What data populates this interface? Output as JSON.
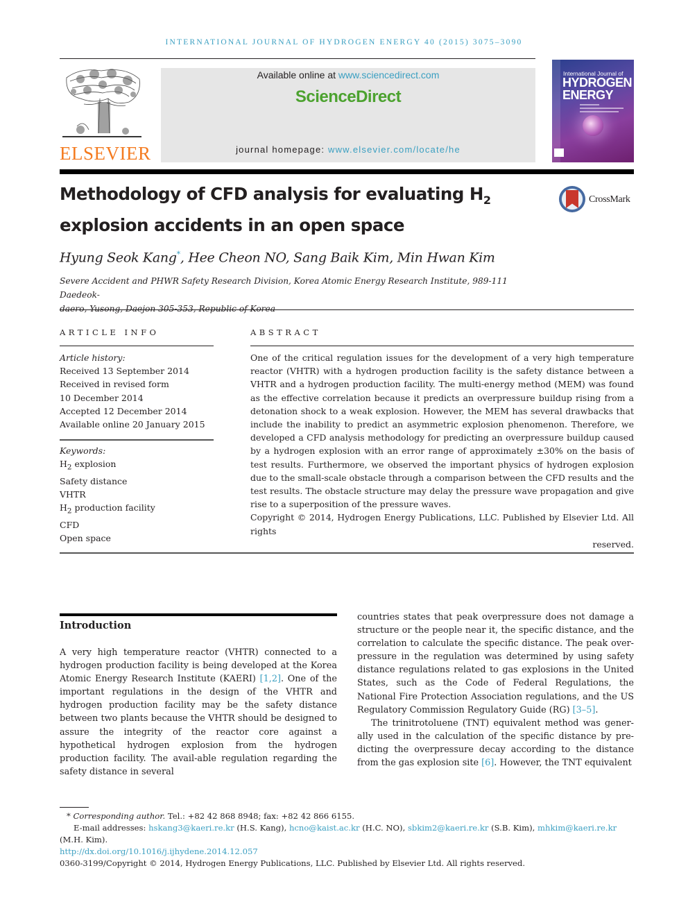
{
  "running_head": "INTERNATIONAL JOURNAL OF HYDROGEN ENERGY 40 (2015) 3075–3090",
  "masthead": {
    "publisher_logo": "ELSEVIER",
    "available_online_prefix": "Available online at ",
    "available_online_link": "www.sciencedirect.com",
    "brand": "ScienceDirect",
    "homepage_prefix": "journal homepage: ",
    "homepage_link": "www.elsevier.com/locate/he",
    "cover": {
      "line1": "International Journal of",
      "line2": "HYDROGEN",
      "line3": "ENERGY"
    }
  },
  "article": {
    "title_part1": "Methodology of CFD analysis for evaluating H",
    "title_sub": "2",
    "title_part2": "explosion accidents in an open space",
    "crossmark_label": "CrossMark",
    "authors_first": "Hyung Seok Kang",
    "authors_mark": "*",
    "authors_rest": ", Hee Cheon NO, Sang Baik Kim, Min Hwan Kim",
    "affiliation_line1": "Severe Accident and PHWR Safety Research Division, Korea Atomic Energy Research Institute, 989-111 Daedeok-",
    "affiliation_line2": "daero, Yusong, Daejon 305-353, Republic of Korea"
  },
  "article_info": {
    "heading": "ARTICLE INFO",
    "history_label": "Article history:",
    "history": [
      "Received 13 September 2014",
      "Received in revised form",
      "10 December 2014",
      "Accepted 12 December 2014",
      "Available online 20 January 2015"
    ],
    "keywords_label": "Keywords:",
    "keywords": [
      {
        "pre": "H",
        "sub": "2",
        "post": " explosion"
      },
      {
        "pre": "Safety distance",
        "sub": "",
        "post": ""
      },
      {
        "pre": "VHTR",
        "sub": "",
        "post": ""
      },
      {
        "pre": "H",
        "sub": "2",
        "post": " production facility"
      },
      {
        "pre": "CFD",
        "sub": "",
        "post": ""
      },
      {
        "pre": "Open space",
        "sub": "",
        "post": ""
      }
    ]
  },
  "abstract": {
    "heading": "ABSTRACT",
    "text": "One of the critical regulation issues for the development of a very high temperature reactor (VHTR) with a hydrogen production facility is the safety distance between a VHTR and a hydrogen production facility. The multi-energy method (MEM) was found as the effective correlation because it predicts an overpressure buildup rising from a detonation shock to a weak explosion. However, the MEM has several drawbacks that include the inability to predict an asymmetric explosion phenomenon. Therefore, we developed a CFD analysis methodology for predicting an overpressure buildup caused by a hydrogen explosion with an error range of approximately ±30% on the basis of test results. Furthermore, we observed the important physics of hydrogen explosion due to the small-scale obstacle through a comparison between the CFD results and the test results. The obstacle structure may delay the pressure wave propagation and give rise to a superposition of the pressure waves.",
    "copyright_line1": "Copyright © 2014, Hydrogen Energy Publications, LLC. Published by Elsevier Ltd. All rights",
    "copyright_line2": "reserved."
  },
  "introduction": {
    "heading": "Introduction",
    "left_p1_a": "A very high temperature reactor (VHTR) connected to a hydrogen production facility is being developed at the Korea Atomic Energy Research Institute (KAERI) ",
    "left_p1_ref": "[1,2]",
    "left_p1_b": ". One of the important regulations in the design of the VHTR and hydrogen production facility may be the safety distance between two plants because the VHTR should be designed to assure the integrity of the reactor core against a hypothetical hydrogen explosion from the hydrogen production facility. The avail-able regulation regarding the safety distance in several",
    "right_p1_a": "countries states that peak overpressure does not damage a structure or the people near it, the specific distance, and the correlation to calculate the specific distance. The peak over-pressure in the regulation was determined by using safety distance regulations related to gas explosions in the United States, such as the Code of Federal Regulations, the National Fire Protection Association regulations, and the US Regulatory Commission Regulatory Guide (RG) ",
    "right_p1_ref": "[3–5]",
    "right_p1_b": ".",
    "right_p2_a": "The trinitrotoluene (TNT) equivalent method was gener-ally used in the calculation of the specific distance by pre-dicting the overpressure decay according to the distance from the gas explosion site ",
    "right_p2_ref": "[6]",
    "right_p2_b": ". However, the TNT equivalent"
  },
  "footnotes": {
    "corr_mark": "* ",
    "corr_label": "Corresponding author.",
    "corr_contact": " Tel.: +82 42 868 8948; fax: +82 42 866 6155.",
    "email_label": "E-mail addresses: ",
    "emails": [
      {
        "addr": "hskang3@kaeri.re.kr",
        "who": " (H.S. Kang), "
      },
      {
        "addr": "hcno@kaist.ac.kr",
        "who": " (H.C. NO), "
      },
      {
        "addr": "sbkim2@kaeri.re.kr",
        "who": " (S.B. Kim), "
      },
      {
        "addr": "mhkim@kaeri.re.kr",
        "who": " (M.H. Kim)."
      }
    ],
    "doi": "http://dx.doi.org/10.1016/j.ijhydene.2014.12.057",
    "issn_copyright": "0360-3199/Copyright © 2014, Hydrogen Energy Publications, LLC. Published by Elsevier Ltd. All rights reserved."
  },
  "colors": {
    "link": "#3a9fc1",
    "elsevier_orange": "#f47b20",
    "sciencedirect_green": "#4ca22f",
    "masthead_gray": "#e6e6e6"
  }
}
